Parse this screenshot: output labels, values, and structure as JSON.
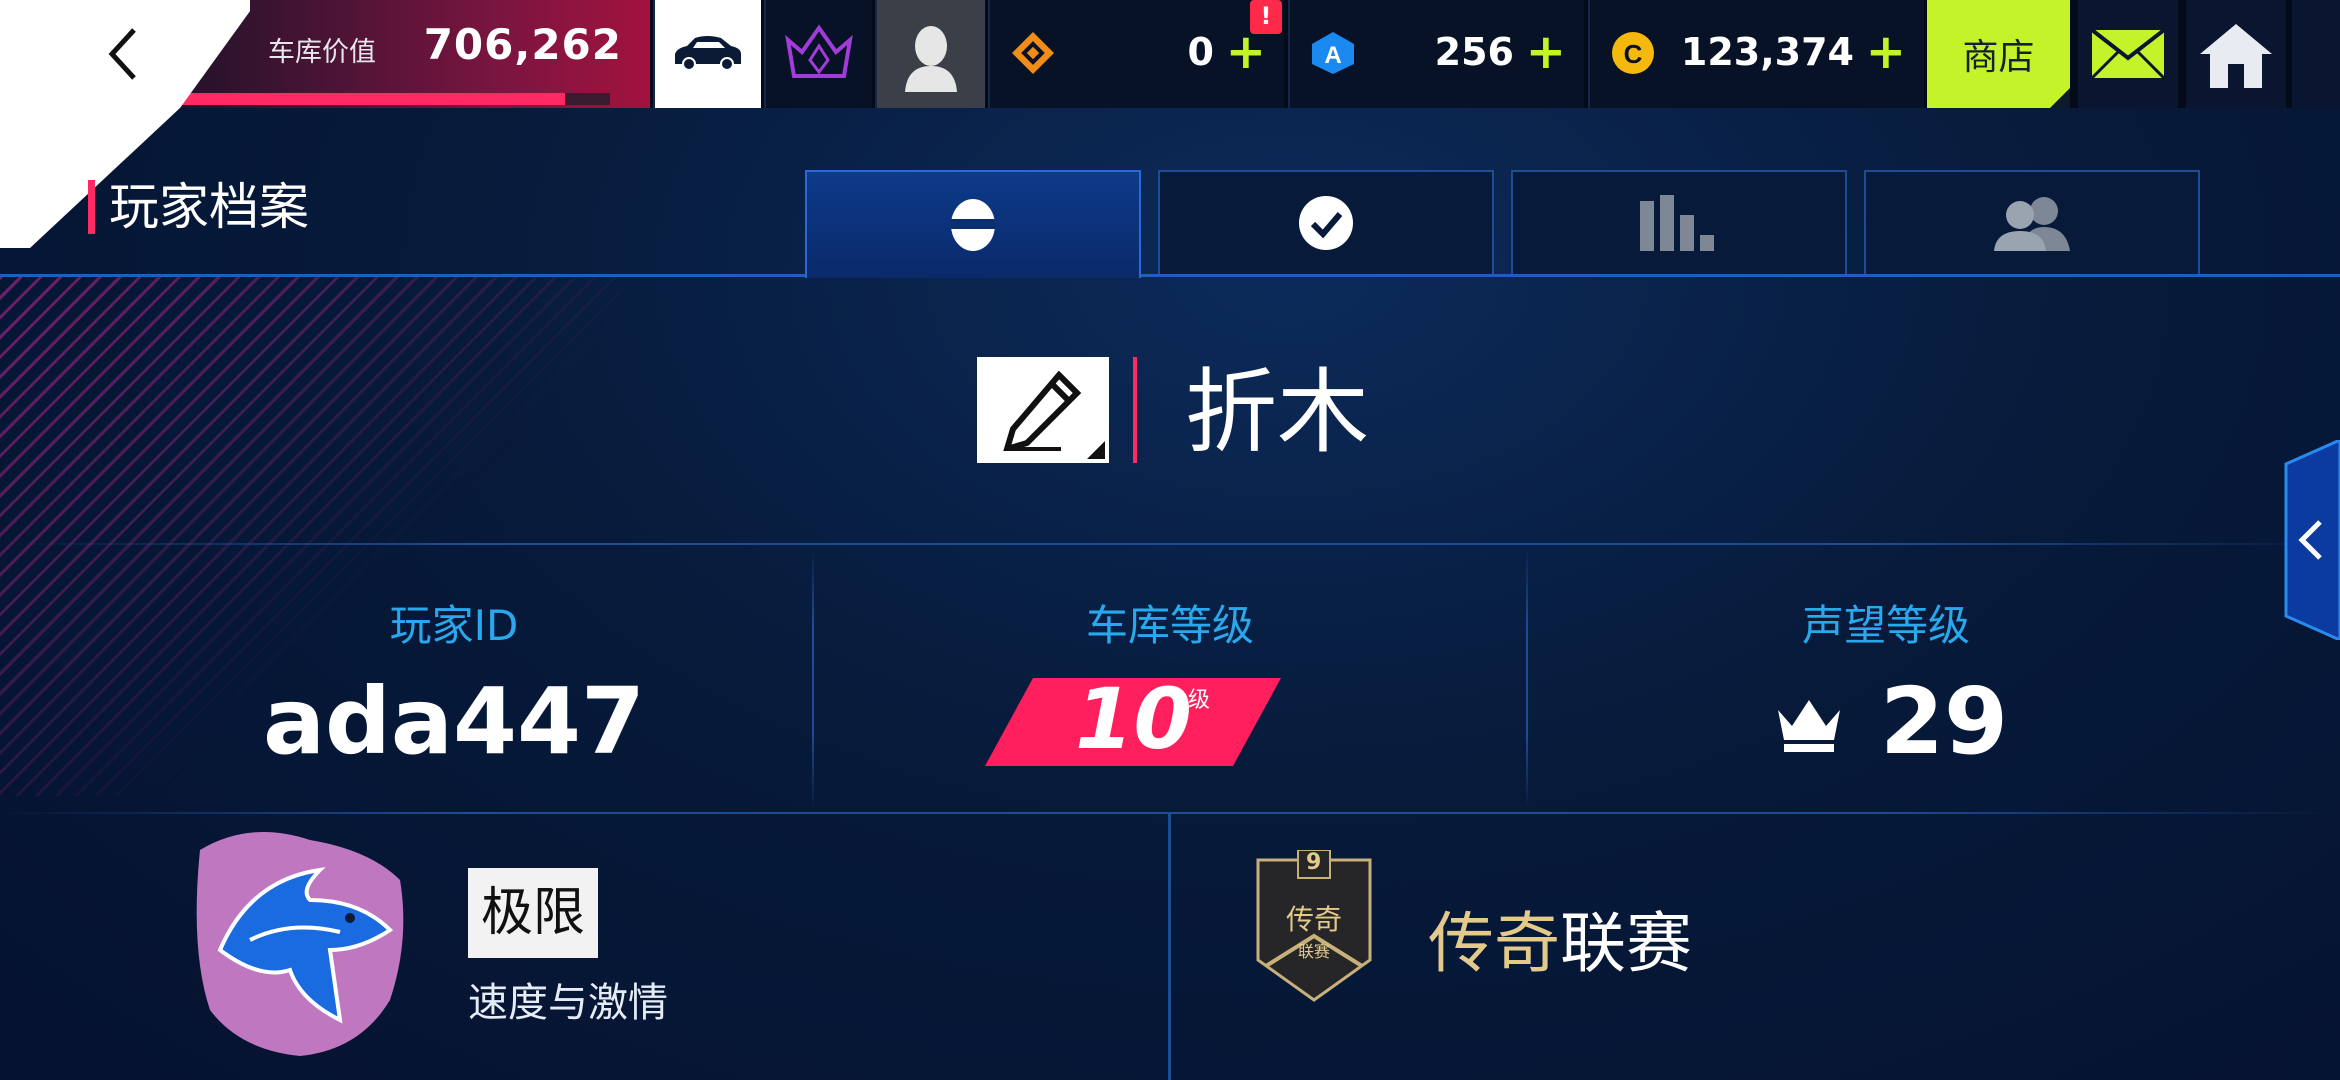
{
  "colors": {
    "accent_pink": "#ff2a62",
    "accent_lime": "#c4f32a",
    "label_blue": "#2aa8ee"
  },
  "topbar": {
    "garage_label": "车库价值",
    "garage_value": "706,262",
    "garage_progress": 0.9,
    "notification_badge": "!",
    "currencies": [
      {
        "icon": "gem-icon",
        "value": "0"
      },
      {
        "icon": "a-token-icon",
        "value": "256"
      },
      {
        "icon": "c-coin-icon",
        "value": "123,374"
      }
    ],
    "shop_label": "商店"
  },
  "page": {
    "title": "玩家档案"
  },
  "tabs": [
    {
      "icon": "helmet-icon"
    },
    {
      "icon": "check-icon"
    },
    {
      "icon": "stats-icon"
    },
    {
      "icon": "friends-icon"
    }
  ],
  "profile": {
    "name": "折木"
  },
  "stats": {
    "player_id_label": "玩家ID",
    "player_id": "ada447",
    "garage_level_label": "车库等级",
    "garage_level": "10",
    "garage_level_unit": "级",
    "fame_label": "声望等级",
    "fame_level": "29"
  },
  "club": {
    "tag": "极限",
    "subtitle": "速度与激情"
  },
  "league": {
    "badge_number": "9",
    "badge_text": "传奇",
    "badge_subtext": "联赛",
    "name_part1": "传奇",
    "name_part2": "联赛"
  }
}
